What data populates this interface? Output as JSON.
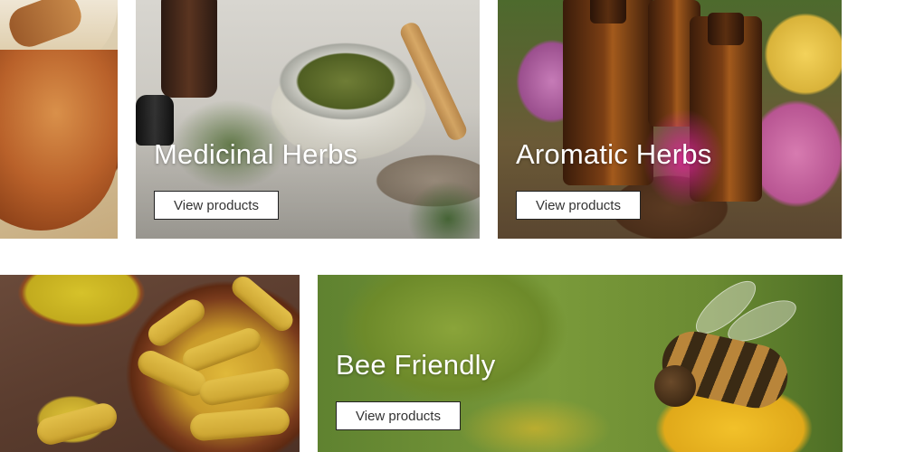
{
  "tiles": [
    {
      "id": "mortar",
      "title": "",
      "button_label": ""
    },
    {
      "id": "medicinal",
      "title": "Medicinal Herbs",
      "button_label": "View products"
    },
    {
      "id": "aromatic",
      "title": "Aromatic Herbs",
      "button_label": "View products"
    },
    {
      "id": "turmeric",
      "title": "",
      "button_label": ""
    },
    {
      "id": "bee",
      "title": "Bee Friendly",
      "button_label": "View products"
    }
  ],
  "colors": {
    "title_text": "#ffffff",
    "button_background": "#ffffff",
    "button_border": "#222222",
    "button_text": "#333333",
    "page_background": "#ffffff"
  }
}
